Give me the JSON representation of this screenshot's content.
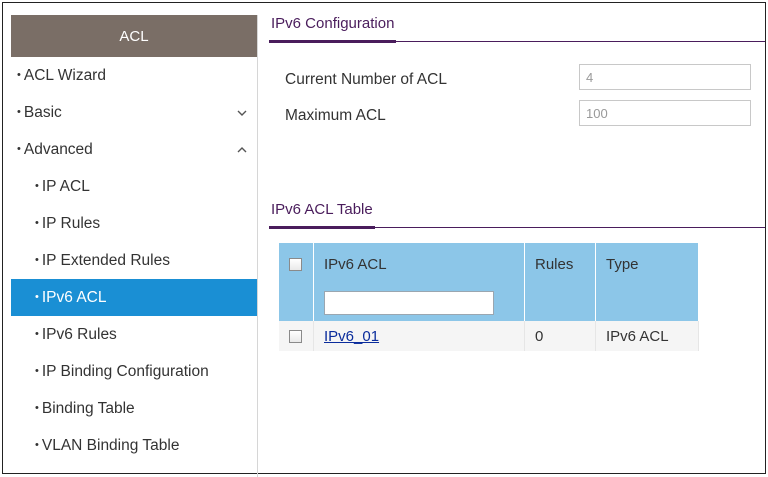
{
  "sidebar": {
    "title": "ACL",
    "items": [
      {
        "label": "ACL Wizard"
      },
      {
        "label": "Basic",
        "chevron": "chevron-down-icon"
      },
      {
        "label": "Advanced",
        "chevron": "chevron-up-icon"
      },
      {
        "label": "IP ACL"
      },
      {
        "label": "IP Rules"
      },
      {
        "label": "IP Extended Rules"
      },
      {
        "label": "IPv6 ACL",
        "active": true
      },
      {
        "label": "IPv6 Rules"
      },
      {
        "label": "IP Binding Configuration"
      },
      {
        "label": "Binding Table"
      },
      {
        "label": "VLAN Binding Table"
      }
    ]
  },
  "config": {
    "title": "IPv6 Configuration",
    "current_label": "Current Number of ACL",
    "current_value": "4",
    "max_label": "Maximum ACL",
    "max_value": "100"
  },
  "table": {
    "title": "IPv6 ACL Table",
    "headers": [
      "IPv6 ACL",
      "Rules",
      "Type"
    ],
    "filter_value": "",
    "rows": [
      {
        "acl": "IPv6_01",
        "rules": "0",
        "type": "IPv6 ACL"
      }
    ]
  },
  "colors": {
    "sidebar_header": "#7a6e66",
    "active_item": "#1a8fd4",
    "table_header": "#8cc6e8",
    "section_title": "#4a1d5c"
  }
}
